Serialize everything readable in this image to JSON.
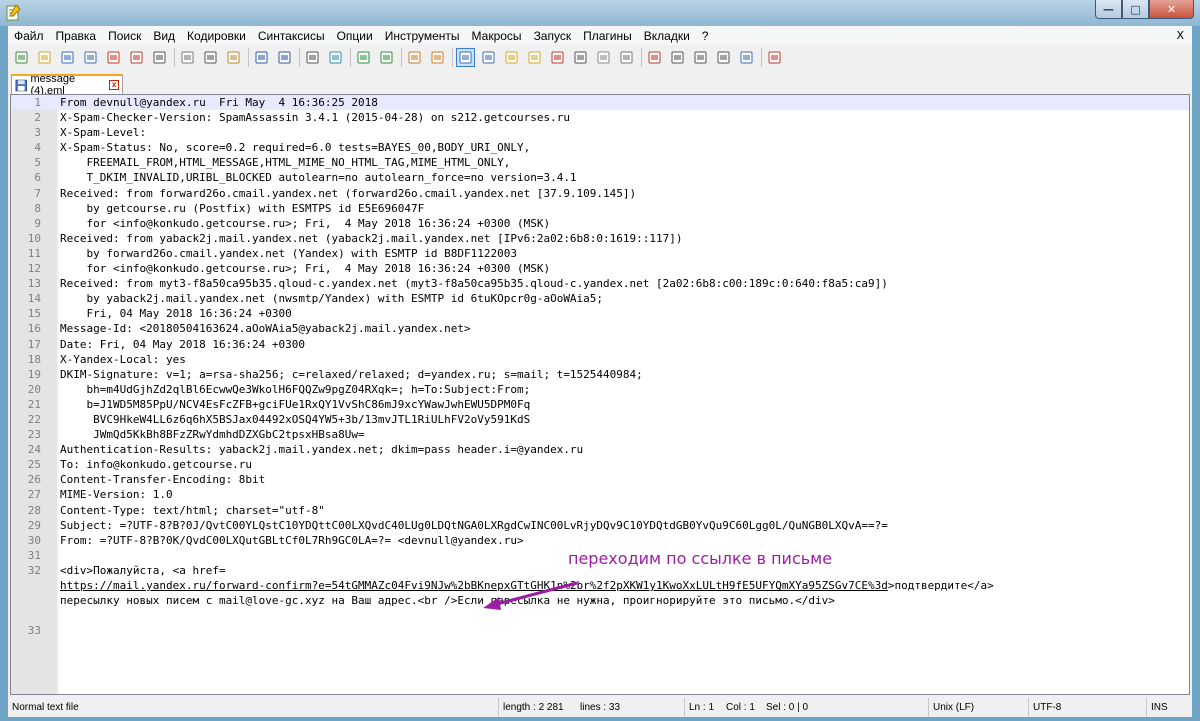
{
  "window": {
    "minimize_glyph": "—",
    "maximize_glyph": "□",
    "close_glyph": "✕"
  },
  "menu": [
    "Файл",
    "Правка",
    "Поиск",
    "Вид",
    "Кодировки",
    "Синтаксисы",
    "Опции",
    "Инструменты",
    "Макросы",
    "Запуск",
    "Плагины",
    "Вкладки",
    "?"
  ],
  "menu_close": "X",
  "toolbar": [
    "new-file",
    "open-file",
    "save",
    "save-all",
    "close",
    "close-all",
    "print",
    "cut",
    "copy",
    "paste",
    "undo",
    "redo",
    "find",
    "replace",
    "zoom-in",
    "zoom-out",
    "sync-vertical",
    "sync-horizontal",
    "word-wrap",
    "show-all-chars",
    "indent-guide",
    "user-defined-lang",
    "doc-map",
    "function-list",
    "folder-as-workspace",
    "monitoring",
    "record-macro",
    "stop-record",
    "play-macro",
    "play-macro-multiple",
    "save-macro",
    "spell-check"
  ],
  "tab": {
    "label": "message (4).eml",
    "close": "x"
  },
  "lines": [
    {
      "n": "1",
      "text": "From devnull@yandex.ru  Fri May  4 16:36:25 2018"
    },
    {
      "n": "2",
      "text": "X-Spam-Checker-Version: SpamAssassin 3.4.1 (2015-04-28) on s212.getcourses.ru"
    },
    {
      "n": "3",
      "text": "X-Spam-Level:"
    },
    {
      "n": "4",
      "text": "X-Spam-Status: No, score=0.2 required=6.0 tests=BAYES_00,BODY_URI_ONLY,"
    },
    {
      "n": "5",
      "text": "    FREEMAIL_FROM,HTML_MESSAGE,HTML_MIME_NO_HTML_TAG,MIME_HTML_ONLY,"
    },
    {
      "n": "6",
      "text": "    T_DKIM_INVALID,URIBL_BLOCKED autolearn=no autolearn_force=no version=3.4.1"
    },
    {
      "n": "7",
      "text": "Received: from forward26o.cmail.yandex.net (forward26o.cmail.yandex.net [37.9.109.145])"
    },
    {
      "n": "8",
      "text": "    by getcourse.ru (Postfix) with ESMTPS id E5E696047F"
    },
    {
      "n": "9",
      "text": "    for <info@konkudo.getcourse.ru>; Fri,  4 May 2018 16:36:24 +0300 (MSK)"
    },
    {
      "n": "10",
      "text": "Received: from yaback2j.mail.yandex.net (yaback2j.mail.yandex.net [IPv6:2a02:6b8:0:1619::117])"
    },
    {
      "n": "11",
      "text": "    by forward26o.cmail.yandex.net (Yandex) with ESMTP id B8DF1122003"
    },
    {
      "n": "12",
      "text": "    for <info@konkudo.getcourse.ru>; Fri,  4 May 2018 16:36:24 +0300 (MSK)"
    },
    {
      "n": "13",
      "text": "Received: from myt3-f8a50ca95b35.qloud-c.yandex.net (myt3-f8a50ca95b35.qloud-c.yandex.net [2a02:6b8:c00:189c:0:640:f8a5:ca9])"
    },
    {
      "n": "14",
      "text": "    by yaback2j.mail.yandex.net (nwsmtp/Yandex) with ESMTP id 6tuKOpcr0g-aOoWAia5;"
    },
    {
      "n": "15",
      "text": "    Fri, 04 May 2018 16:36:24 +0300"
    },
    {
      "n": "16",
      "text": "Message-Id: <20180504163624.aOoWAia5@yaback2j.mail.yandex.net>"
    },
    {
      "n": "17",
      "text": "Date: Fri, 04 May 2018 16:36:24 +0300"
    },
    {
      "n": "18",
      "text": "X-Yandex-Local: yes"
    },
    {
      "n": "19",
      "text": "DKIM-Signature: v=1; a=rsa-sha256; c=relaxed/relaxed; d=yandex.ru; s=mail; t=1525440984;"
    },
    {
      "n": "20",
      "text": "    bh=m4UdGjhZd2qlBl6EcwwQe3WkolH6FQQZw9pgZ04RXqk=; h=To:Subject:From;"
    },
    {
      "n": "21",
      "text": "    b=J1WD5M85PpU/NCV4EsFcZFB+gciFUe1RxQY1VvShC86mJ9xcYWawJwhEWU5DPM0Fq"
    },
    {
      "n": "22",
      "text": "     BVC9HkeW4LL6z6q6hX5BSJax04492xOSQ4YW5+3b/13mvJTL1RiULhFV2oVy591KdS"
    },
    {
      "n": "23",
      "text": "     JWmQd5KkBh8BFzZRwYdmhdDZXGbC2tpsxHBsa8Uw="
    },
    {
      "n": "24",
      "text": "Authentication-Results: yaback2j.mail.yandex.net; dkim=pass header.i=@yandex.ru"
    },
    {
      "n": "25",
      "text": "To: info@konkudo.getcourse.ru"
    },
    {
      "n": "26",
      "text": "Content-Transfer-Encoding: 8bit"
    },
    {
      "n": "27",
      "text": "MIME-Version: 1.0"
    },
    {
      "n": "28",
      "text": "Content-Type: text/html; charset=\"utf-8\""
    },
    {
      "n": "29",
      "text": "Subject: =?UTF-8?B?0J/QvtC00YLQstC10YDQttC00LXQvdC40LUg0LDQtNGA0LXRgdCwINC00LvRjyDQv9C10YDQtdGB0YvQu9C60Lgg0L/QuNGB0LXQvA==?="
    },
    {
      "n": "30",
      "text": "From: =?UTF-8?B?0K/QvdC00LXQutGBLtCf0L7Rh9GC0LA=?= <devnull@yandex.ru>"
    },
    {
      "n": "31",
      "text": ""
    },
    {
      "n": "32",
      "text": "<div>Пожалуйста, <a href="
    },
    {
      "n": "",
      "text": "",
      "link": "https://mail.yandex.ru/forward-confirm?e=54tGMMAZc04Fvi9NJw%2bBKnepxGTtGHK1n%2br%2f2pXKW1y1KwoXxLULtH9fE5UFYQmXYa95ZSGv7CE%3d",
      "tail": ">подтвердите</a>"
    },
    {
      "n": "",
      "text": "пересылку новых писем с mail@love-gc.xyz на Ваш адрес.<br />Если пересылка не нужна, проигнорируйте это письмо.</div>"
    },
    {
      "n": "",
      "text": ""
    },
    {
      "n": "33",
      "text": ""
    }
  ],
  "annotation": "переходим по ссылке в письме",
  "annotation_color": "#9c1da5",
  "status": {
    "type": "Normal text file",
    "length": "length : 2 281",
    "lines": "lines : 33",
    "ln": "Ln : 1",
    "col": "Col : 1",
    "sel": "Sel : 0 | 0",
    "eol": "Unix (LF)",
    "encoding": "UTF-8",
    "mode": "INS"
  }
}
